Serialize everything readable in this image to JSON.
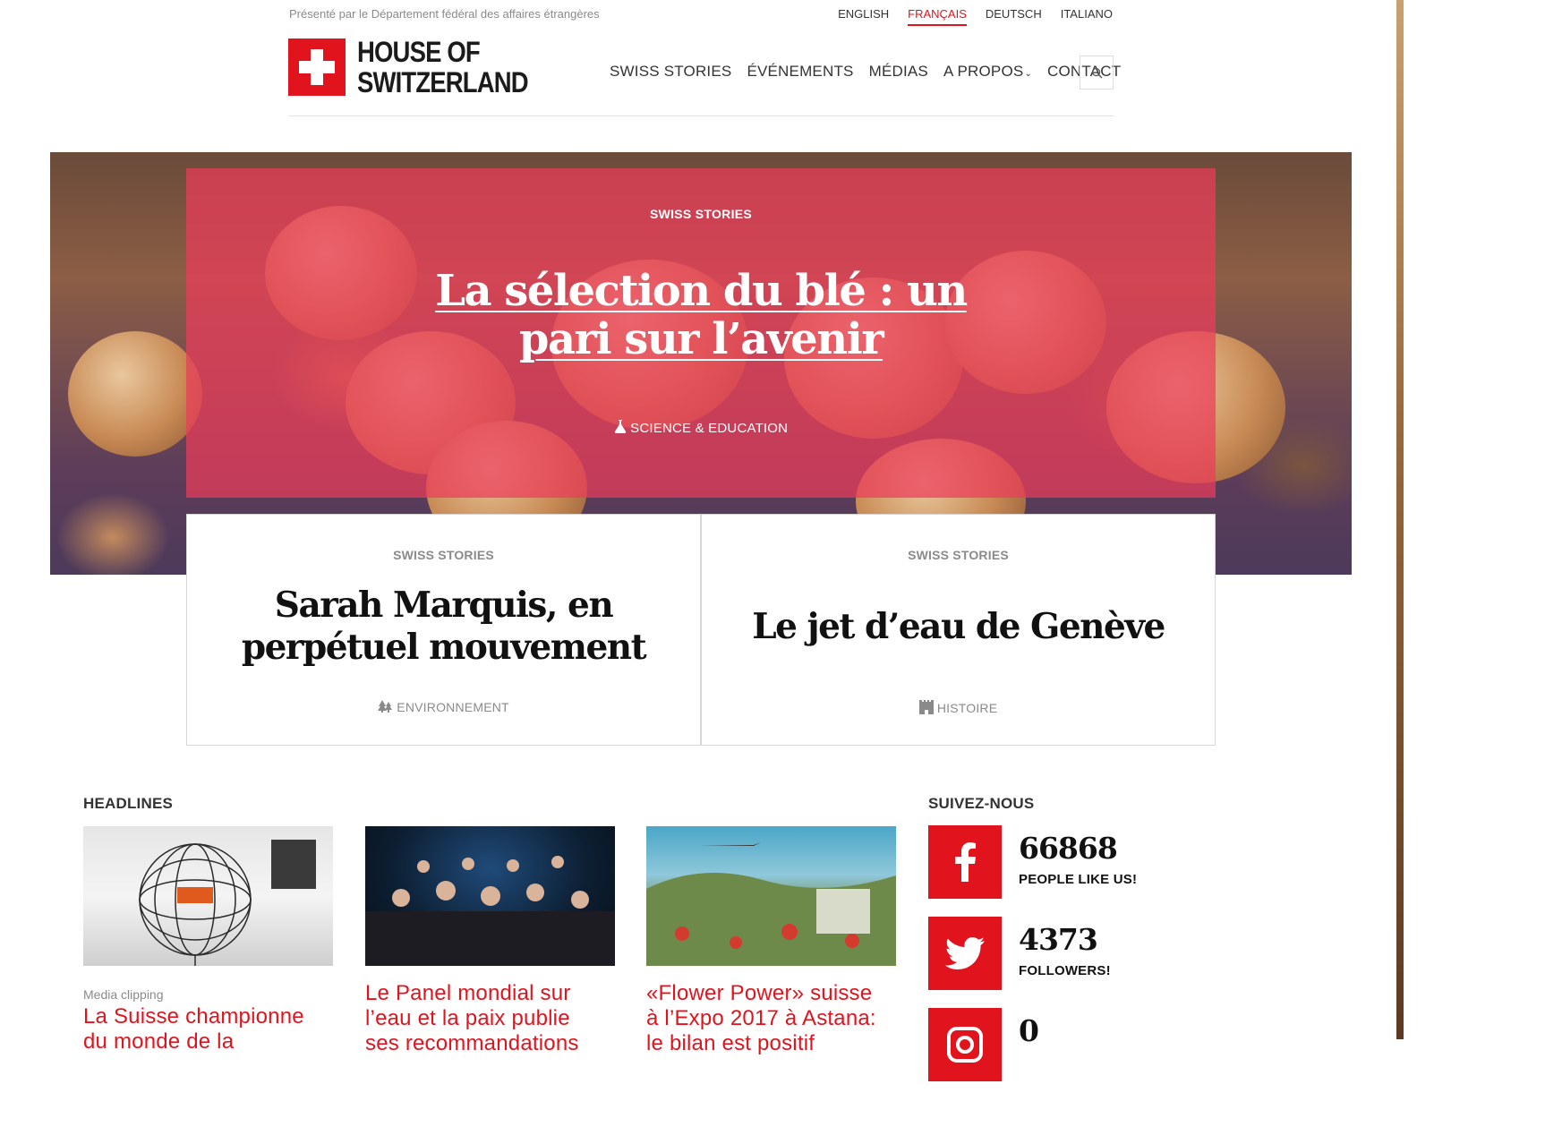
{
  "header": {
    "presented_by": "Présenté par le Département fédéral des affaires étrangères",
    "languages": [
      {
        "label": "ENGLISH",
        "active": false
      },
      {
        "label": "FRANÇAIS",
        "active": true
      },
      {
        "label": "DEUTSCH",
        "active": false
      },
      {
        "label": "ITALIANO",
        "active": false
      }
    ],
    "logo_line1": "HOUSE OF",
    "logo_line2": "SWITZERLAND",
    "nav": [
      "SWISS STORIES",
      "ÉVÉNEMENTS",
      "MÉDIAS",
      "A PROPOS",
      "CONTACT"
    ],
    "search_icon": "search-icon"
  },
  "hero": {
    "category": "SWISS STORIES",
    "title_line1": "La sélection du blé : un",
    "title_line2": "pari sur l’avenir",
    "tag": "SCIENCE & EDUCATION",
    "tag_icon": "flask-icon"
  },
  "cards": [
    {
      "category": "SWISS STORIES",
      "title_line1": "Sarah Marquis, en",
      "title_line2": "perpétuel mouvement",
      "tag": "ENVIRONNEMENT",
      "tag_icon": "trees-icon"
    },
    {
      "category": "SWISS STORIES",
      "title_line1": "Le jet d’eau de Genève",
      "tag": "HISTOIRE",
      "tag_icon": "castle-icon"
    }
  ],
  "headlines": {
    "heading": "HEADLINES",
    "items": [
      {
        "label": "Media clipping",
        "title_line1": "La Suisse championne",
        "title_line2": "du monde de la"
      },
      {
        "title_line1": "Le Panel mondial sur",
        "title_line2": "l’eau et la paix publie",
        "title_line3": "ses recommandations"
      },
      {
        "title_line1": "«Flower Power» suisse",
        "title_line2": "à l’Expo 2017 à Astana:",
        "title_line3": "le bilan est positif"
      }
    ]
  },
  "social": {
    "heading": "SUIVEZ-NOUS",
    "items": [
      {
        "network": "facebook",
        "icon": "facebook-icon",
        "count": "66868",
        "label": "PEOPLE LIKE US!"
      },
      {
        "network": "twitter",
        "icon": "twitter-icon",
        "count": "4373",
        "label": "FOLLOWERS!"
      },
      {
        "network": "instagram",
        "icon": "instagram-icon",
        "count": "0"
      }
    ]
  },
  "colors": {
    "brand_red": "#e1141e",
    "hero_overlay": "#eb3c5a"
  }
}
